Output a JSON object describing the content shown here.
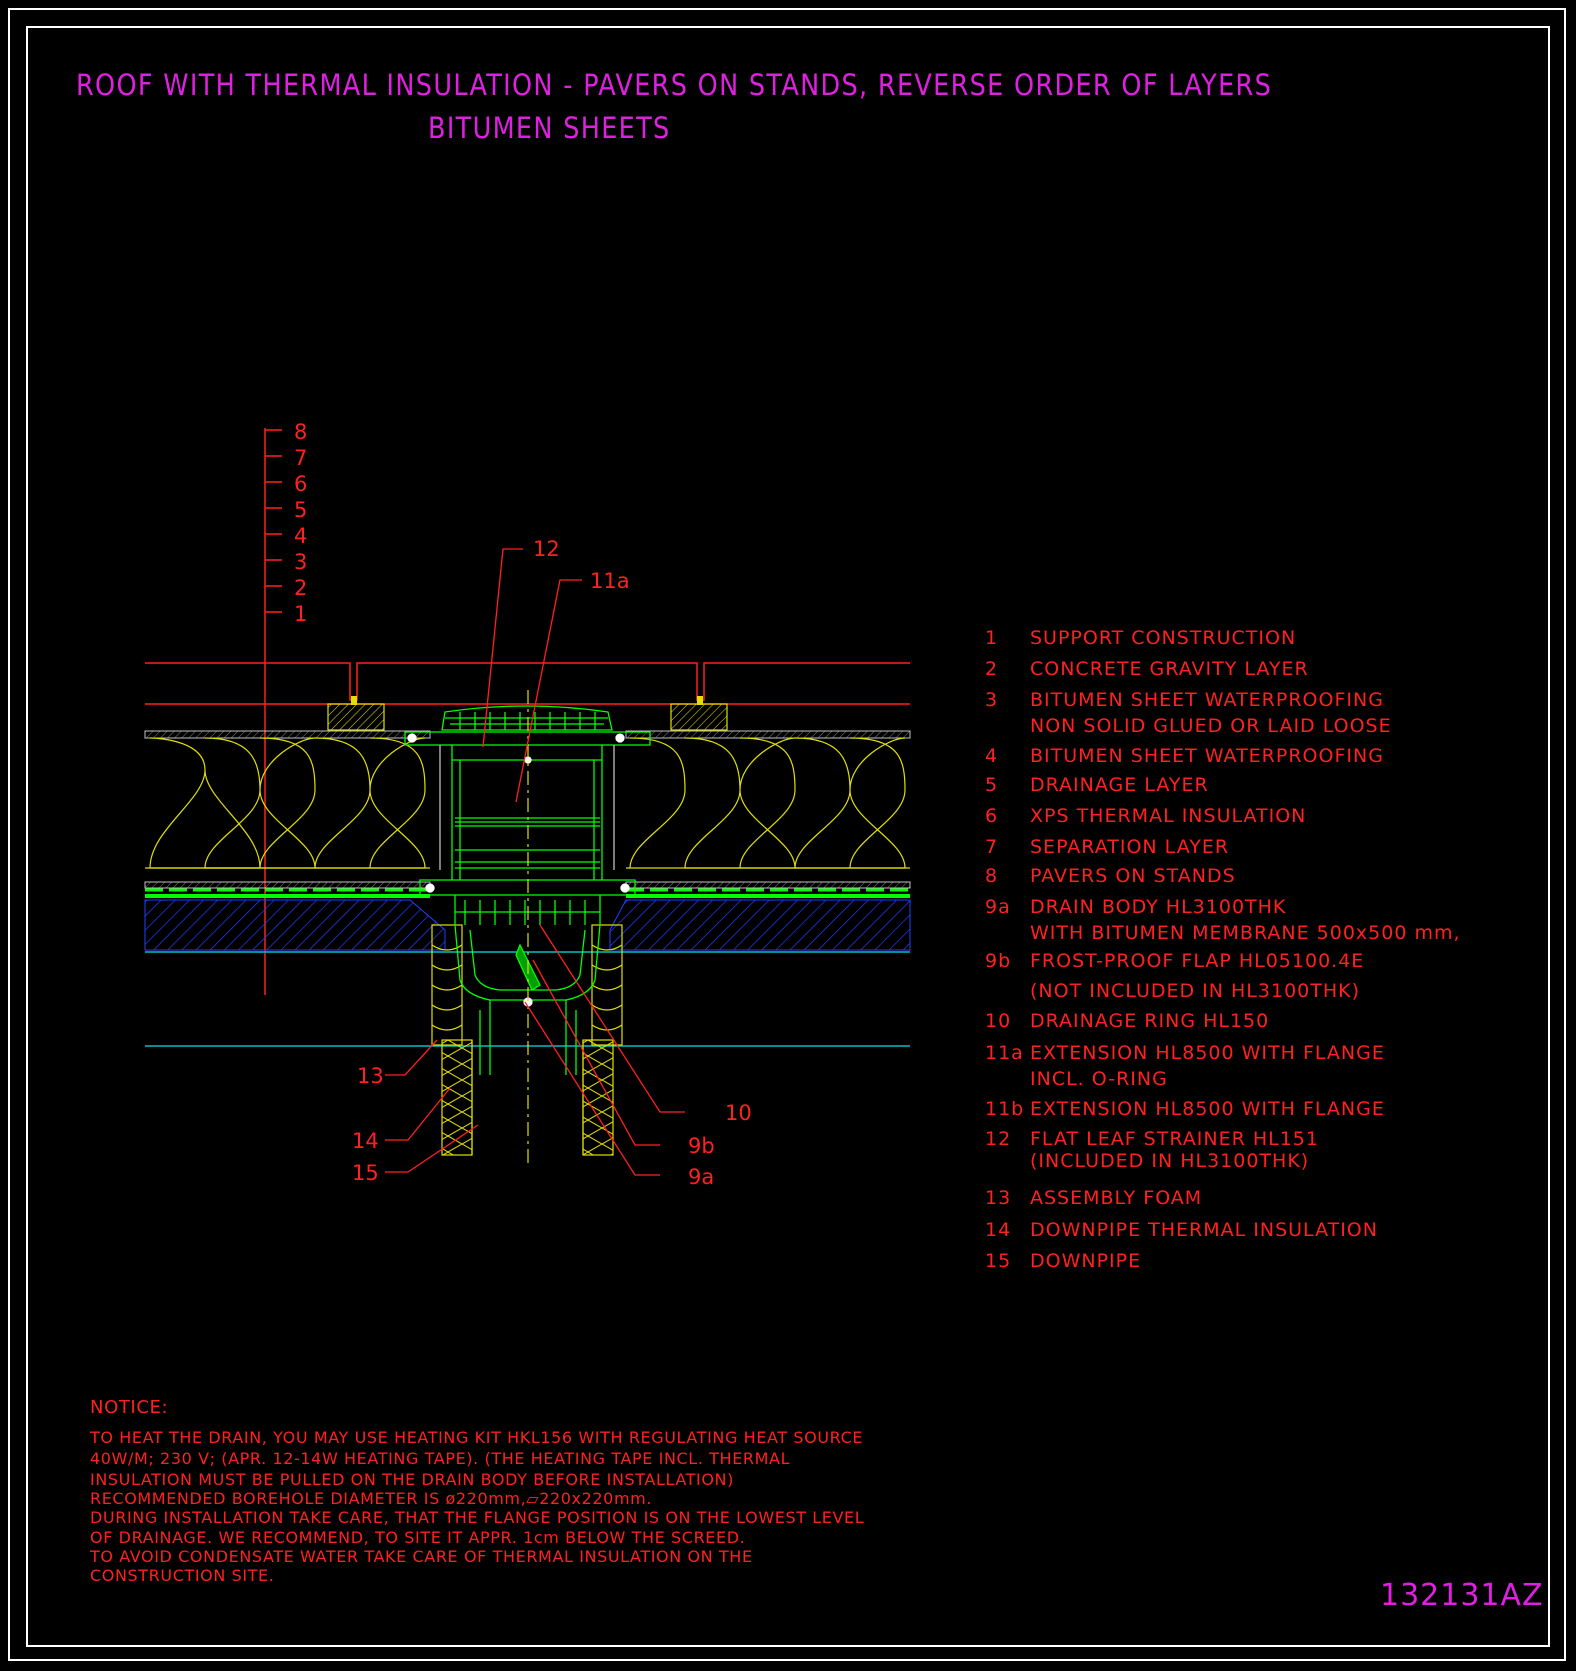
{
  "title": {
    "line1": "ROOF WITH THERMAL INSULATION - PAVERS ON STANDS, REVERSE ORDER OF LAYERS",
    "line2": "BITUMEN SHEETS"
  },
  "layer_scale": [
    "8",
    "7",
    "6",
    "5",
    "4",
    "3",
    "2",
    "1"
  ],
  "callouts": {
    "c12": "12",
    "c11a": "11a",
    "c13": "13",
    "c14": "14",
    "c15": "15",
    "c10": "10",
    "c9b": "9b",
    "c9a": "9a"
  },
  "legend": [
    {
      "num": "1",
      "text": "SUPPORT CONSTRUCTION"
    },
    {
      "num": "2",
      "text": "CONCRETE GRAVITY LAYER"
    },
    {
      "num": "3",
      "text": "BITUMEN SHEET WATERPROOFING",
      "text2": "NON SOLID GLUED OR LAID LOOSE"
    },
    {
      "num": "4",
      "text": "BITUMEN SHEET WATERPROOFING"
    },
    {
      "num": "5",
      "text": "DRAINAGE LAYER"
    },
    {
      "num": "6",
      "text": "XPS THERMAL INSULATION"
    },
    {
      "num": "7",
      "text": "SEPARATION LAYER"
    },
    {
      "num": "8",
      "text": "PAVERS ON STANDS"
    },
    {
      "num": "9a",
      "text": "DRAIN BODY HL3100THK",
      "text2": "WITH BITUMEN MEMBRANE 500x500 mm,"
    },
    {
      "num": "9b",
      "text": "FROST-PROOF FLAP HL05100.4E",
      "text2": "(NOT INCLUDED IN HL3100THK)"
    },
    {
      "num": "10",
      "text": "DRAINAGE RING HL150"
    },
    {
      "num": "11a",
      "text": "EXTENSION HL8500 WITH FLANGE",
      "text2": "INCL. O-RING"
    },
    {
      "num": "11b",
      "text": "EXTENSION HL8500 WITH FLANGE"
    },
    {
      "num": "12",
      "text": "FLAT LEAF STRAINER HL151",
      "text2": "(INCLUDED IN HL3100THK)"
    },
    {
      "num": "13",
      "text": "ASSEMBLY FOAM"
    },
    {
      "num": "14",
      "text": "DOWNPIPE THERMAL INSULATION"
    },
    {
      "num": "15",
      "text": "DOWNPIPE"
    }
  ],
  "notice": {
    "heading": "NOTICE:",
    "lines": [
      "TO HEAT THE DRAIN, YOU MAY USE HEATING KIT HKL156 WITH REGULATING HEAT SOURCE",
      "40W/M; 230 V;  (APR. 12-14W HEATING TAPE). (THE HEATING TAPE INCL. THERMAL",
      "INSULATION MUST BE PULLED ON THE DRAIN BODY BEFORE INSTALLATION)",
      "RECOMMENDED BOREHOLE DIAMETER IS ø220mm,▱220x220mm.",
      "DURING INSTALLATION TAKE CARE, THAT THE FLANGE POSITION IS ON THE LOWEST LEVEL",
      "OF DRAINAGE. WE RECOMMEND, TO SITE IT APPR. 1cm BELOW THE SCREED.",
      "TO AVOID CONDENSATE WATER TAKE CARE OF THERMAL INSULATION ON THE",
      "CONSTRUCTION SITE."
    ]
  },
  "drawing_code": "132131AZ",
  "colors": {
    "background": "#000000",
    "title": "#e020e0",
    "annotation": "#ff2020",
    "drain": "#00ff00",
    "insulation": "#e0e000",
    "concrete_hatch": "#2040ff",
    "ground_line": "#00c0c0",
    "frame": "#ffffff"
  }
}
